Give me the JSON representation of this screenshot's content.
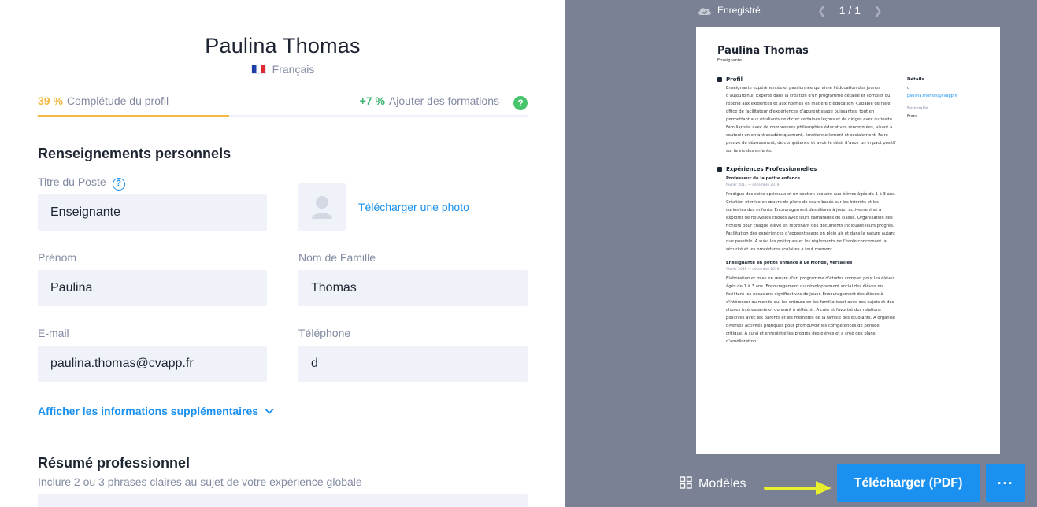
{
  "profile": {
    "full_name": "Paulina Thomas",
    "language": "Français"
  },
  "progress": {
    "completion_pct": "39 %",
    "completion_label": "Complétude du profil",
    "completion_fraction": 0.39,
    "bonus_pct": "+7 %",
    "bonus_label": "Ajouter des formations",
    "help_icon": "?"
  },
  "personal": {
    "section_title": "Renseignements personnels",
    "job_title_label": "Titre du Poste",
    "job_title_value": "Enseignante",
    "upload_photo": "Télécharger une photo",
    "first_name_label": "Prénom",
    "first_name_value": "Paulina",
    "last_name_label": "Nom de Famille",
    "last_name_value": "Thomas",
    "email_label": "E-mail",
    "email_value": "paulina.thomas@cvapp.fr",
    "phone_label": "Téléphone",
    "phone_value": "d",
    "more_info": "Afficher les informations supplémentaires"
  },
  "summary": {
    "section_title": "Résumé professionnel",
    "subtitle": "Inclure 2 ou 3 phrases claires au sujet de votre expérience globale"
  },
  "preview": {
    "saved_status": "Enregistré",
    "page_indicator": "1 / 1",
    "templates_label": "Modèles",
    "download_label": "Télécharger (PDF)",
    "more_label": "···",
    "resume": {
      "name": "Paulina Thomas",
      "role": "Enseignante",
      "profile_heading": "Profil",
      "profile_text": "Enseignante expérimentée et passionnée qui aime l'éducation des jeunes d'aujourd'hui. Experte dans la création d'un programme détaillé et complet qui répond aux exigences et aux normes en matière d'éducation. Capable de faire office de facilitateur d'expériences d'apprentissage puissantes, tout en permettant aux étudiants de dicter certaines leçons et de diriger avec curiosité. Familiarisée avec de nombreuses philosophies éducatives renommées, visant à soutenir un enfant académiquement, émotionnellement et socialement. Faire preuve de dévouement, de compétence et avoir le désir d'avoir un impact positif sur la vie des enfants.",
      "details_heading": "Détails",
      "details_phone": "d",
      "details_email": "paulina.thomas@cvapp.fr",
      "nationality_label": "Nationalité",
      "nationality_value": "Frans",
      "experience_heading": "Expériences Professionnelles",
      "jobs": [
        {
          "title": "Professeur de la petite enfance",
          "dates": "février 2013 — décembre 2019",
          "text": "Prodigue des soins optimaux et un soutien scolaire aux élèves âgés de 1 à 3 ans. Création et mise en œuvre de plans de cours basés sur les intérêts et les curiosités des enfants. Encouragement des élèves à jouer activement et à explorer de nouvelles choses avec leurs camarades de classe. Organisation des fichiers pour chaque élève en reprenant des documents indiquant leurs progrès. Facilitation des expériences d'apprentissage en plein air et dans la nature autant que possible. A suivi les politiques et les règlements de l'école concernant la sécurité et les procédures scolaires à tout moment."
        },
        {
          "title": "Enseignante en petite enfance à Le Monde, Versailles",
          "dates": "février 2018 — décembre 2019",
          "text": "Elaboration et mise en œuvre d'un programme d'études complet pour les élèves âgés de 1 à 3 ans. Encouragement du développement social des élèves en facilitant les occasions significatives de jouer. Encouragement des élèves à s'intéresser au monde qui les entoure en les familiarisant avec des sujets et des choses intéressants et donnant à réfléchir. A créé et favorisé des relations positives avec les parents et les membres de la famille des étudiants. A organisé diverses activités pratiques pour promouvoir les compétences de pensée critique. A suivi et enregistré les progrès des élèves et a créé des plans d'amélioration."
        }
      ]
    }
  },
  "colors": {
    "accent": "#1a91f0",
    "warning": "#f2b945",
    "success": "#3cb371",
    "preview_bg": "#7a8195",
    "input_bg": "#eff2f9"
  }
}
